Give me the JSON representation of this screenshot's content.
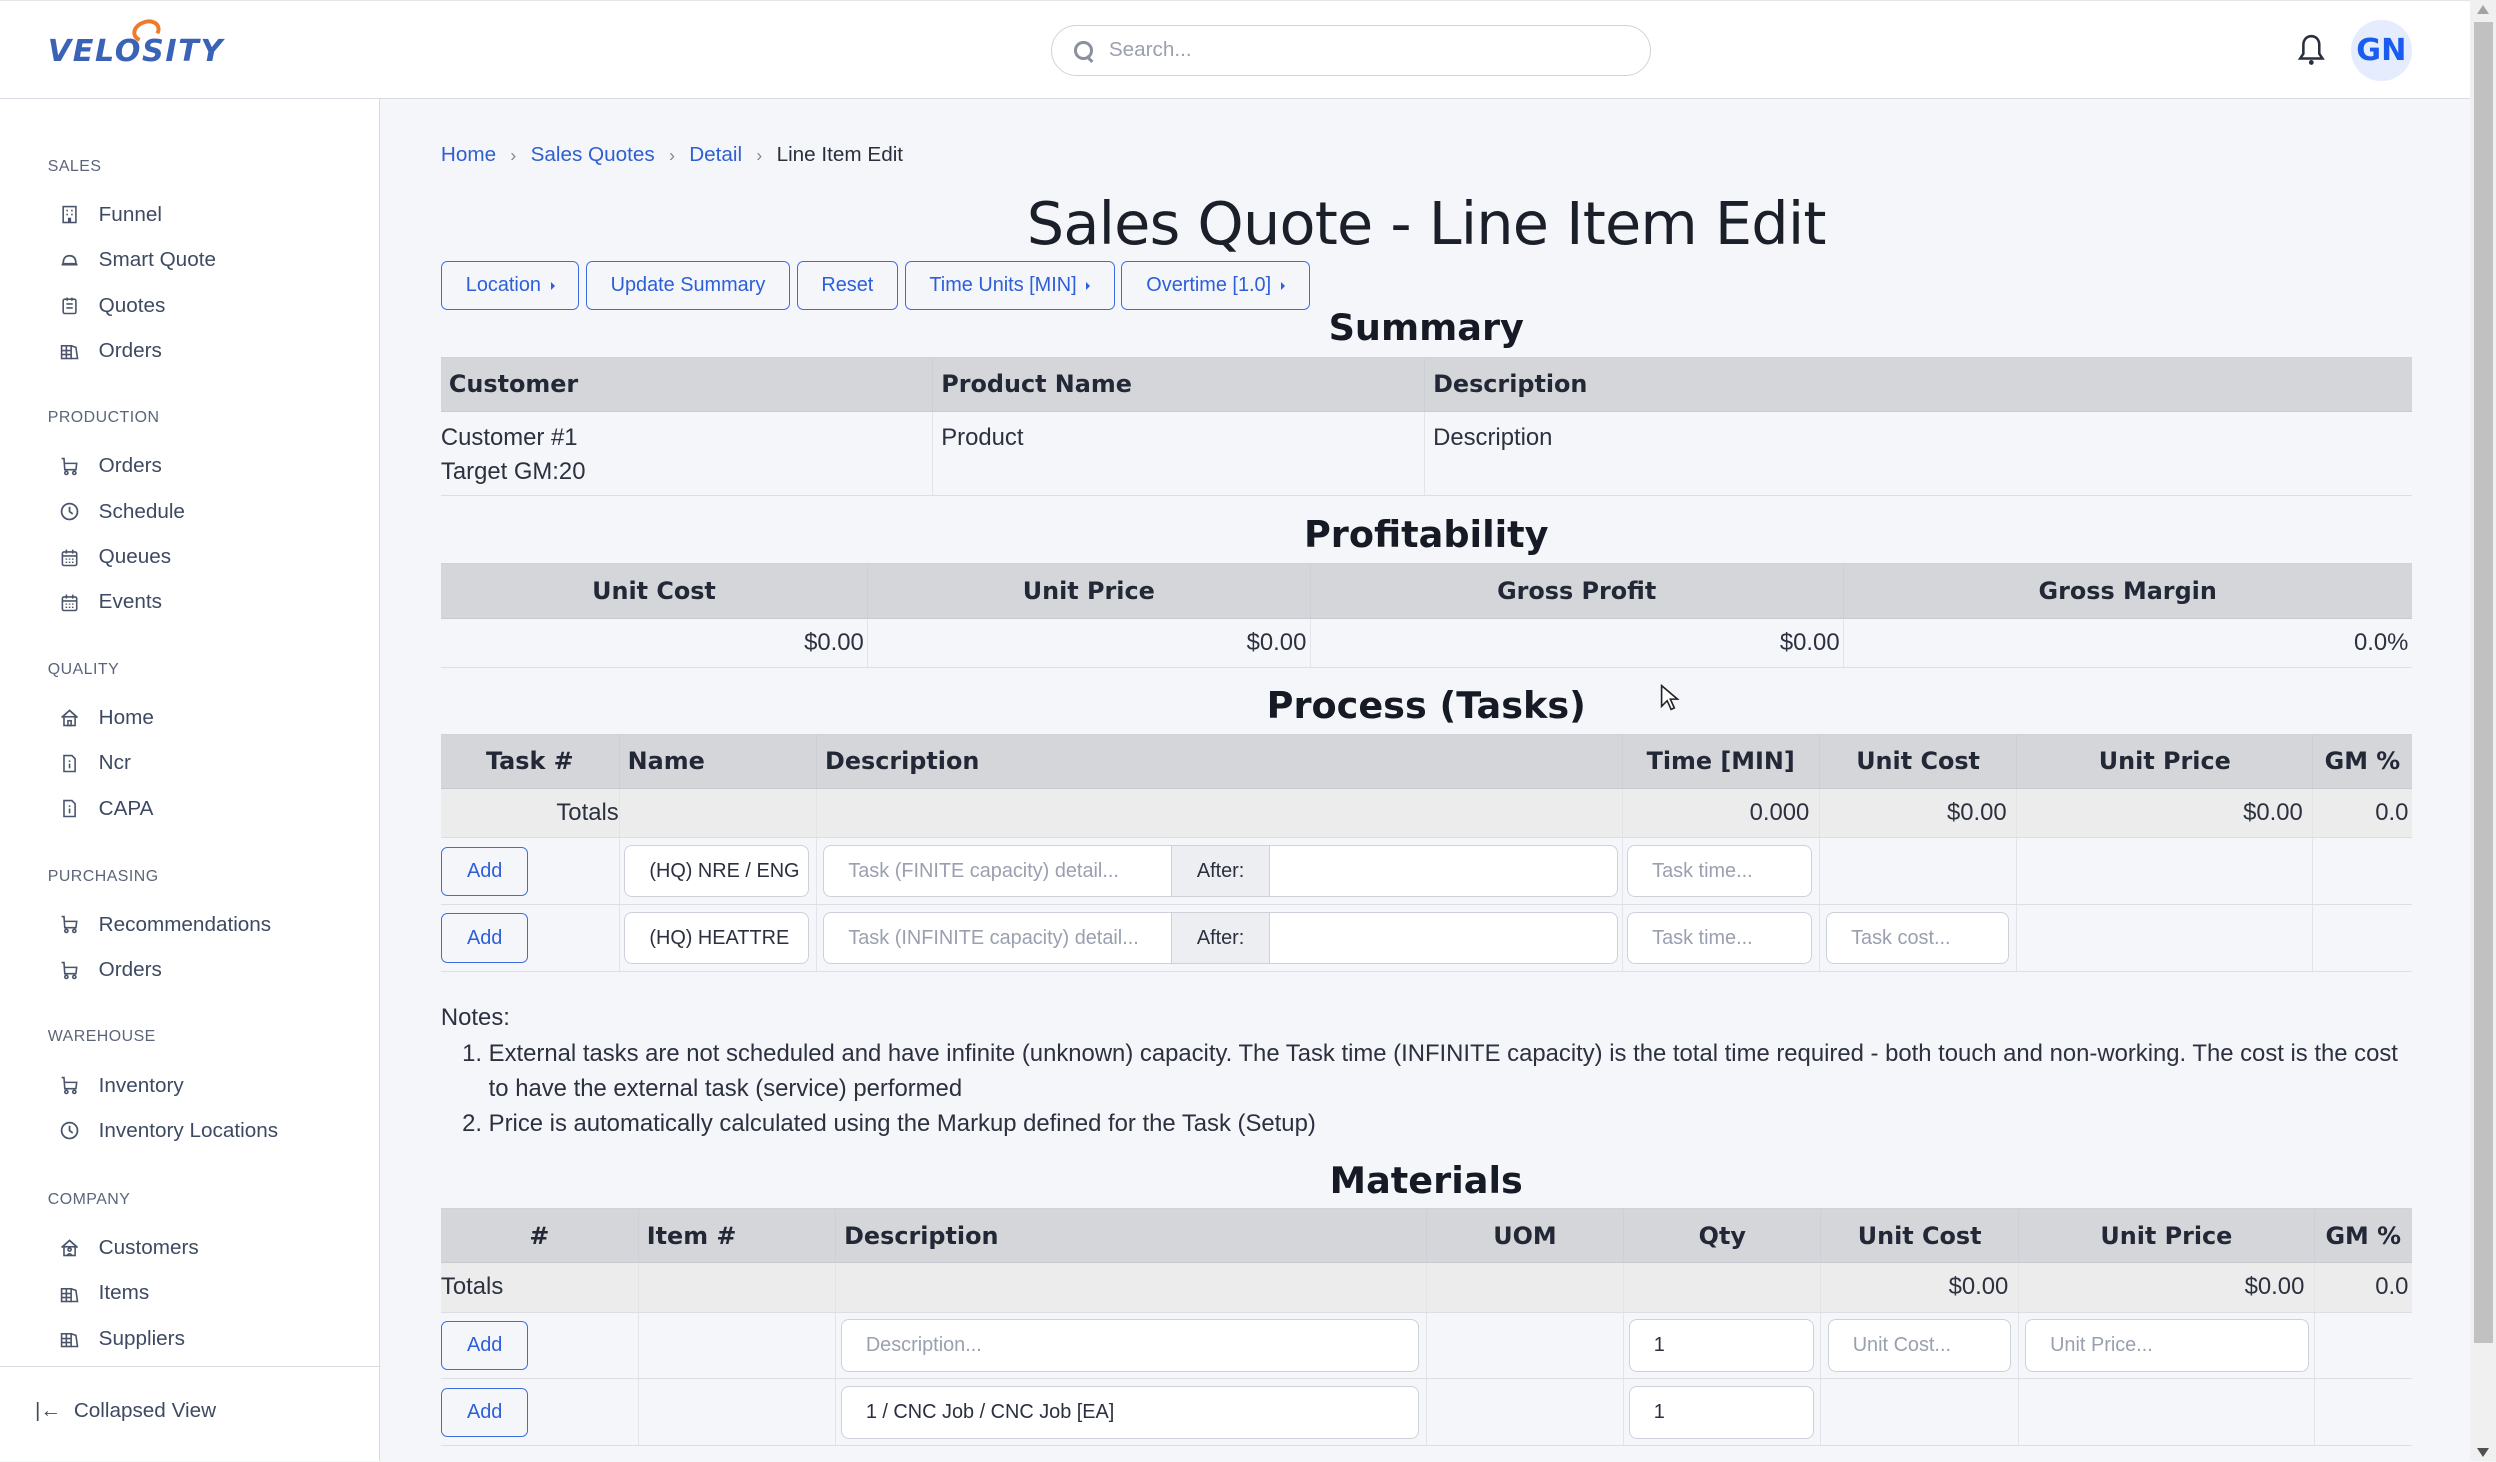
{
  "app": {
    "brand": "VELOSITY"
  },
  "header": {
    "search_placeholder": "Search...",
    "avatar_initials": "GN",
    "accent": "#2c5fd8"
  },
  "sidebar": {
    "sections": [
      {
        "title": "SALES",
        "items": [
          {
            "label": "Funnel",
            "icon": "building-icon"
          },
          {
            "label": "Smart Quote",
            "icon": "hard-hat-icon"
          },
          {
            "label": "Quotes",
            "icon": "clipboard-icon"
          },
          {
            "label": "Orders",
            "icon": "warehouse-icon"
          }
        ]
      },
      {
        "title": "PRODUCTION",
        "items": [
          {
            "label": "Orders",
            "icon": "cart-icon"
          },
          {
            "label": "Schedule",
            "icon": "clock-icon"
          },
          {
            "label": "Queues",
            "icon": "calendar-icon"
          },
          {
            "label": "Events",
            "icon": "calendar-icon"
          }
        ]
      },
      {
        "title": "QUALITY",
        "items": [
          {
            "label": "Home",
            "icon": "home-icon"
          },
          {
            "label": "Ncr",
            "icon": "file-info-icon"
          },
          {
            "label": "CAPA",
            "icon": "file-info-icon"
          }
        ]
      },
      {
        "title": "PURCHASING",
        "items": [
          {
            "label": "Recommendations",
            "icon": "cart-icon"
          },
          {
            "label": "Orders",
            "icon": "cart-icon"
          }
        ]
      },
      {
        "title": "WAREHOUSE",
        "items": [
          {
            "label": "Inventory",
            "icon": "cart-icon"
          },
          {
            "label": "Inventory Locations",
            "icon": "clock-icon"
          }
        ]
      },
      {
        "title": "COMPANY",
        "items": [
          {
            "label": "Customers",
            "icon": "home-user-icon"
          },
          {
            "label": "Items",
            "icon": "warehouse-icon"
          },
          {
            "label": "Suppliers",
            "icon": "warehouse-icon"
          }
        ]
      }
    ],
    "collapse_label": "Collapsed View"
  },
  "breadcrumb": [
    {
      "label": "Home",
      "link": true
    },
    {
      "label": "Sales Quotes",
      "link": true
    },
    {
      "label": "Detail",
      "link": true
    },
    {
      "label": "Line Item Edit",
      "link": false
    }
  ],
  "page_title": "Sales Quote - Line Item Edit",
  "toolbar": {
    "location": "Location",
    "update_summary": "Update Summary",
    "reset": "Reset",
    "time_units": "Time Units [MIN]",
    "overtime": "Overtime [1.0]"
  },
  "summary": {
    "title": "Summary",
    "headers": [
      "Customer",
      "Product Name",
      "Description"
    ],
    "customer": "Customer #1",
    "target_gm": "Target GM:20",
    "product": "Product",
    "description": "Description"
  },
  "profitability": {
    "title": "Profitability",
    "headers": [
      "Unit Cost",
      "Unit Price",
      "Gross Profit",
      "Gross Margin"
    ],
    "values": [
      "$0.00",
      "$0.00",
      "$0.00",
      "0.0%"
    ]
  },
  "process": {
    "title": "Process (Tasks)",
    "headers": [
      "Task #",
      "Name",
      "Description",
      "Time [MIN]",
      "Unit Cost",
      "Unit Price",
      "GM %"
    ],
    "totals": {
      "label": "Totals",
      "time": "0.000",
      "unit_cost": "$0.00",
      "unit_price": "$0.00",
      "gm": "0.0"
    },
    "rows": [
      {
        "add": "Add",
        "name": "(HQ) NRE / ENG",
        "desc_placeholder": "Task (FINITE capacity) detail...",
        "after_label": "After:",
        "after_value": "",
        "time_placeholder": "Task time...",
        "cost_placeholder": ""
      },
      {
        "add": "Add",
        "name": "(HQ) HEATTRE",
        "desc_placeholder": "Task (INFINITE capacity) detail...",
        "after_label": "After:",
        "after_value": "",
        "time_placeholder": "Task time...",
        "cost_placeholder": "Task cost..."
      }
    ]
  },
  "notes": {
    "label": "Notes:",
    "items": [
      "External tasks are not scheduled and have infinite (unknown) capacity. The Task time (INFINITE capacity) is the total time required - both touch and non-working. The cost is the cost to have the external task (service) performed",
      "Price is automatically calculated using the Markup defined for the Task (Setup)"
    ]
  },
  "materials": {
    "title": "Materials",
    "headers": [
      "#",
      "Item #",
      "Description",
      "UOM",
      "Qty",
      "Unit Cost",
      "Unit Price",
      "GM %"
    ],
    "totals": {
      "label": "Totals",
      "unit_cost": "$0.00",
      "unit_price": "$0.00",
      "gm": "0.0"
    },
    "rows": [
      {
        "add": "Add",
        "description_placeholder": "Description...",
        "description": "",
        "qty": "1",
        "unit_cost_placeholder": "Unit Cost...",
        "unit_price_placeholder": "Unit Price..."
      },
      {
        "add": "Add",
        "description": "1 / CNC Job / CNC Job [EA]",
        "qty": "1"
      }
    ]
  }
}
